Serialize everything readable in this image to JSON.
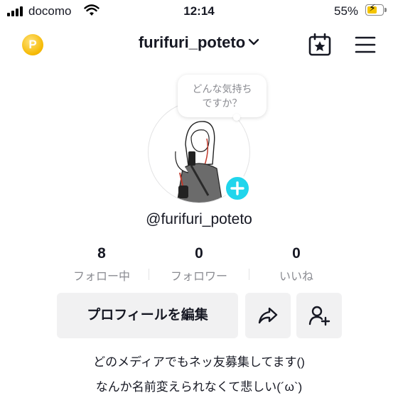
{
  "status_bar": {
    "carrier": "docomo",
    "time": "12:14",
    "battery_percent": "55%",
    "battery_level": 0.55
  },
  "header": {
    "coin_letter": "P",
    "username": "furifuri_poteto"
  },
  "profile": {
    "mood_bubble_line1": "どんな気持ち",
    "mood_bubble_line2": "ですか？",
    "handle": "@furifuri_poteto"
  },
  "stats": [
    {
      "value": "8",
      "label": "フォロー中"
    },
    {
      "value": "0",
      "label": "フォロワー"
    },
    {
      "value": "0",
      "label": "いいね"
    }
  ],
  "buttons": {
    "edit_profile_label": "プロフィールを編集"
  },
  "bio": {
    "line1": "どのメディアでもネッ友募集してます()",
    "line2": "なんか名前変えられなくて悲しい(´ω`)"
  },
  "icons": [
    "signal-icon",
    "wifi-icon",
    "battery-icon",
    "coin-icon",
    "chevron-down-icon",
    "calendar-star-icon",
    "menu-icon",
    "plus-icon",
    "share-icon",
    "add-friend-icon"
  ],
  "colors": {
    "accent_plus": "#20d5ec",
    "button_bg": "#f1f1f2",
    "battery_fill": "#f4c400",
    "secondary_text": "#8a8b91"
  }
}
